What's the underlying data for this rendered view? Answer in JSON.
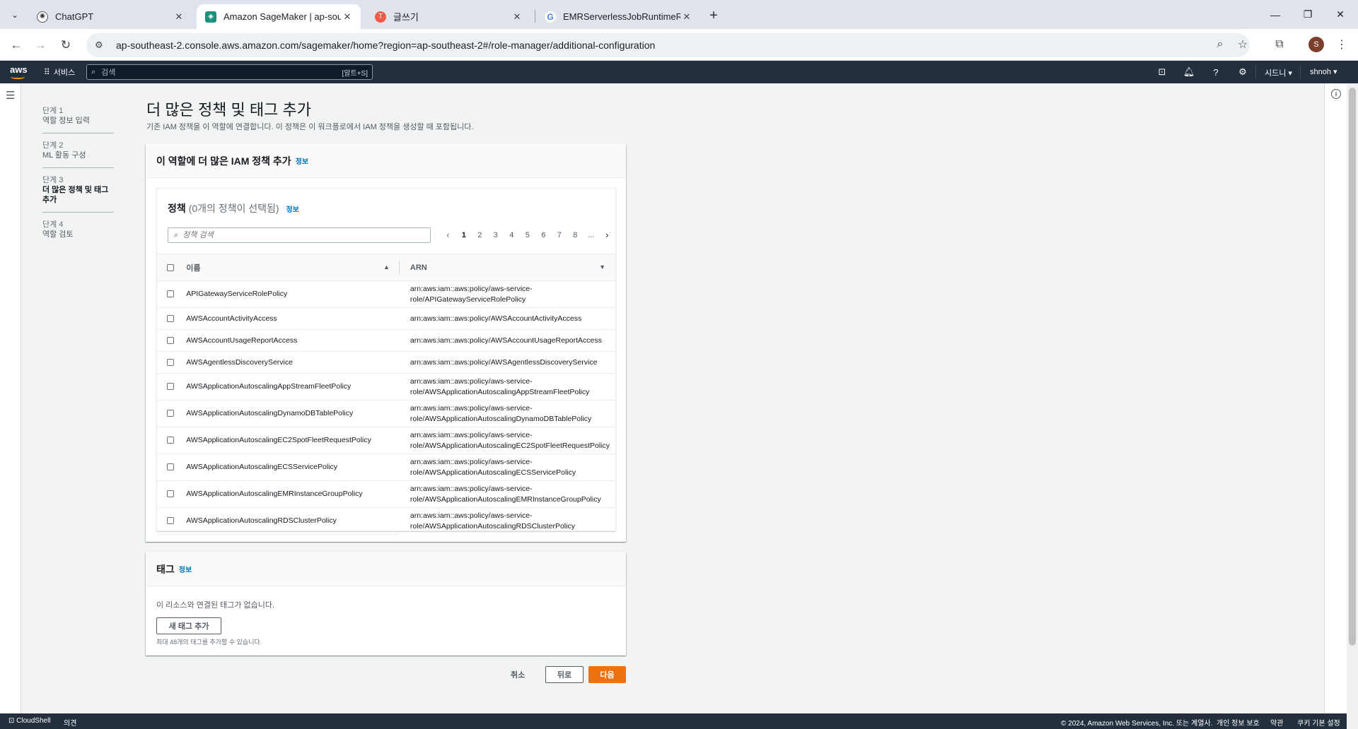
{
  "browser": {
    "tabs": [
      {
        "title": "ChatGPT",
        "icon": "chatgpt-icon",
        "active": false
      },
      {
        "title": "Amazon SageMaker | ap-south",
        "icon": "sagemaker-icon",
        "active": true
      },
      {
        "title": "글쓰기",
        "icon": "tistory-icon",
        "active": false
      },
      {
        "title": "EMRServerlessJobRuntimeRole",
        "icon": "google-icon",
        "active": false
      }
    ],
    "url": "ap-southeast-2.console.aws.amazon.com/sagemaker/home?region=ap-southeast-2#/role-manager/additional-configuration",
    "profile_initial": "S"
  },
  "aws_header": {
    "logo": "aws",
    "services": "서비스",
    "search_placeholder": "검색",
    "search_shortcut": "[알트+S]",
    "region": "시드니",
    "user": "shnoh"
  },
  "steps": [
    {
      "num": "단계 1",
      "name": "역할 정보 입력",
      "current": false
    },
    {
      "num": "단계 2",
      "name": "ML 활동 구성",
      "current": false
    },
    {
      "num": "단계 3",
      "name": "더 많은 정책 및 태그 추가",
      "current": true
    },
    {
      "num": "단계 4",
      "name": "역할 검토",
      "current": false
    }
  ],
  "page": {
    "title": "더 많은 정책 및 태그 추가",
    "description": "기존 IAM 정책을 이 역할에 연결합니다. 이 정책은 이 워크플로에서 IAM 정책을 생성할 때 포함됩니다."
  },
  "policies_container": {
    "header": "이 역할에 더 많은 IAM 정책 추가",
    "info": "정보",
    "table_title": "정책",
    "table_count": "(0개의 정책이 선택됨)",
    "table_info": "정보",
    "search_placeholder": "정책 검색",
    "pagination": {
      "pages": [
        "1",
        "2",
        "3",
        "4",
        "5",
        "6",
        "7",
        "8",
        "..."
      ],
      "current": "1"
    },
    "columns": {
      "name": "이름",
      "arn": "ARN"
    },
    "rows": [
      {
        "name": "APIGatewayServiceRolePolicy",
        "arn": [
          "arn:aws:iam::aws:policy/aws-service-",
          "role/APIGatewayServiceRolePolicy"
        ]
      },
      {
        "name": "AWSAccountActivityAccess",
        "arn": [
          "arn:aws:iam::aws:policy/AWSAccountActivityAccess"
        ]
      },
      {
        "name": "AWSAccountUsageReportAccess",
        "arn": [
          "arn:aws:iam::aws:policy/AWSAccountUsageReportAccess"
        ]
      },
      {
        "name": "AWSAgentlessDiscoveryService",
        "arn": [
          "arn:aws:iam::aws:policy/AWSAgentlessDiscoveryService"
        ]
      },
      {
        "name": "AWSApplicationAutoscalingAppStreamFleetPolicy",
        "arn": [
          "arn:aws:iam::aws:policy/aws-service-",
          "role/AWSApplicationAutoscalingAppStreamFleetPolicy"
        ]
      },
      {
        "name": "AWSApplicationAutoscalingDynamoDBTablePolicy",
        "arn": [
          "arn:aws:iam::aws:policy/aws-service-",
          "role/AWSApplicationAutoscalingDynamoDBTablePolicy"
        ]
      },
      {
        "name": "AWSApplicationAutoscalingEC2SpotFleetRequestPolicy",
        "arn": [
          "arn:aws:iam::aws:policy/aws-service-",
          "role/AWSApplicationAutoscalingEC2SpotFleetRequestPolicy"
        ]
      },
      {
        "name": "AWSApplicationAutoscalingECSServicePolicy",
        "arn": [
          "arn:aws:iam::aws:policy/aws-service-",
          "role/AWSApplicationAutoscalingECSServicePolicy"
        ]
      },
      {
        "name": "AWSApplicationAutoscalingEMRInstanceGroupPolicy",
        "arn": [
          "arn:aws:iam::aws:policy/aws-service-",
          "role/AWSApplicationAutoscalingEMRInstanceGroupPolicy"
        ]
      },
      {
        "name": "AWSApplicationAutoscalingRDSClusterPolicy",
        "arn": [
          "arn:aws:iam::aws:policy/aws-service-",
          "role/AWSApplicationAutoscalingRDSClusterPolicy"
        ]
      }
    ]
  },
  "tags_container": {
    "header": "태그",
    "info": "정보",
    "empty_text": "이 리소스와 연결된 태그가 없습니다.",
    "add_button": "새 태그 추가",
    "hint": "최대 48개의 태그를 추가할 수 있습니다."
  },
  "actions": {
    "cancel": "취소",
    "back": "뒤로",
    "next": "다음"
  },
  "footer": {
    "cloudshell": "CloudShell",
    "feedback": "의견",
    "copyright": "© 2024, Amazon Web Services, Inc. 또는 계열사.",
    "privacy": "개인 정보 보호",
    "terms": "약관",
    "cookies": "쿠키 기본 설정"
  },
  "colors": {
    "aws_dark": "#232f3e",
    "aws_orange": "#ec7211",
    "link": "#0073bb"
  }
}
